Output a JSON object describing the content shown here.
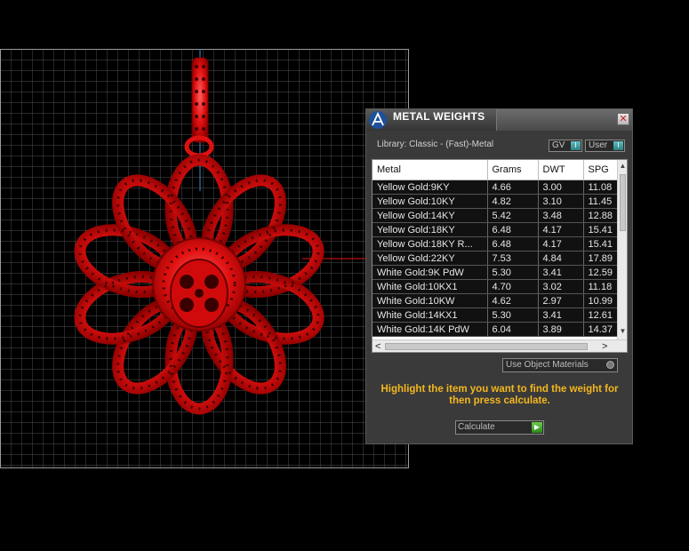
{
  "panel": {
    "title": "METAL WEIGHTS",
    "close_glyph": "✕",
    "library_label": "Library: Classic - (Fast)-Metal",
    "gv_label": "GV",
    "user_label": "User",
    "use_object_materials_label": "Use Object Materials",
    "instruction": "Highlight the item you want to find the weight for then press calculate.",
    "calculate_label": "Calculate"
  },
  "table": {
    "columns": [
      "Metal",
      "Grams",
      "DWT",
      "SPG"
    ],
    "rows": [
      [
        "Yellow Gold:9KY",
        "4.66",
        "3.00",
        "11.08"
      ],
      [
        "Yellow Gold:10KY",
        "4.82",
        "3.10",
        "11.45"
      ],
      [
        "Yellow Gold:14KY",
        "5.42",
        "3.48",
        "12.88"
      ],
      [
        "Yellow Gold:18KY",
        "6.48",
        "4.17",
        "15.41"
      ],
      [
        "Yellow Gold:18KY R...",
        "6.48",
        "4.17",
        "15.41"
      ],
      [
        "Yellow Gold:22KY",
        "7.53",
        "4.84",
        "17.89"
      ],
      [
        "White Gold:9K PdW",
        "5.30",
        "3.41",
        "12.59"
      ],
      [
        "White Gold:10KX1",
        "4.70",
        "3.02",
        "11.18"
      ],
      [
        "White Gold:10KW",
        "4.62",
        "2.97",
        "10.99"
      ],
      [
        "White Gold:14KX1",
        "5.30",
        "3.41",
        "12.61"
      ],
      [
        "White Gold:14K PdW",
        "6.04",
        "3.89",
        "14.37"
      ]
    ]
  },
  "icons": {
    "logo": "app-logo-icon",
    "close": "close-icon",
    "toggle": "toggle-switch-icon",
    "play": "play-arrow-icon"
  },
  "colors": {
    "model_red": "#e01010",
    "instruction_yellow": "#f3b71f",
    "grid_line": "#7a7a7a",
    "toggle_teal": "#3f9f9f",
    "calc_green": "#3caa2a"
  }
}
